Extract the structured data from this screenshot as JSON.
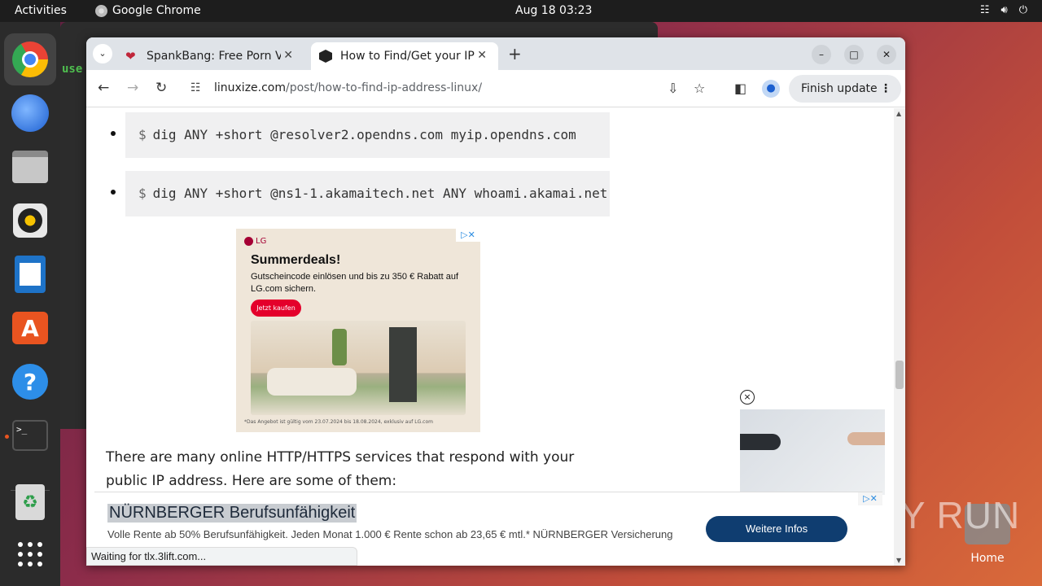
{
  "topbar": {
    "activities": "Activities",
    "app_name": "Google Chrome",
    "clock": "Aug 18  03:23",
    "tray_icons": [
      "network-icon",
      "volume-icon",
      "power-icon"
    ]
  },
  "dock": {
    "items": [
      "chrome-icon",
      "thunderbird-icon",
      "files-icon",
      "rhythmbox-icon",
      "writer-icon",
      "app-center-icon",
      "help-icon",
      "terminal-icon",
      "trash-icon",
      "show-apps-icon"
    ]
  },
  "background_window": {
    "text": "use"
  },
  "tabs": [
    {
      "title": "SpankBang: Free Porn V",
      "close": "✕"
    },
    {
      "title": "How to Find/Get your IP",
      "close": "✕"
    }
  ],
  "browser": {
    "new_tab": "+",
    "url_domain": "linuxize.com",
    "url_path": "/post/how-to-find-ip-address-linux/",
    "finish_update": "Finish update"
  },
  "page": {
    "commands": [
      {
        "prompt": "$",
        "text": "dig ANY +short @resolver2.opendns.com myip.opendns.com"
      },
      {
        "prompt": "$",
        "text": "dig ANY +short @ns1-1.akamaitech.net ANY whoami.akamai.net"
      }
    ],
    "lg_ad": {
      "brand": "LG",
      "headline": "Summerdeals!",
      "subline": "Gutscheincode einlösen und bis zu 350 € Rabatt auf LG.com sichern.",
      "cta": "Jetzt kaufen",
      "fine_print": "*Das Angebot ist gültig vom 23.07.2024 bis 18.08.2024, exklusiv auf LG.com"
    },
    "paragraph": "There are many online HTTP/HTTPS services that respond with your public IP address. Here are some of them:",
    "bottom_ad": {
      "title": "NÜRNBERGER Berufsunfähigkeit",
      "body": "Volle Rente ab 50% Berufsunfähigkeit. Jeden Monat 1.000 € Rente schon ab 23,65 € mtl.* NÜRNBERGER Versicherung",
      "button": "Weitere Infos"
    },
    "side_ad_close": "×"
  },
  "status": "Waiting for tlx.3lift.com...",
  "desktop": {
    "home_label": "Home",
    "watermark": "ANY RUN"
  }
}
